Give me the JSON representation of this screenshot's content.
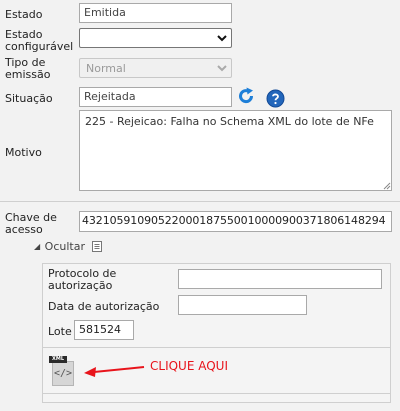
{
  "form": {
    "estado": {
      "label": "Estado",
      "value": "Emitida"
    },
    "estado_configuravel": {
      "label_line1": "Estado",
      "label_line2": "configurável",
      "value": ""
    },
    "tipo_emissao": {
      "label_line1": "Tipo de",
      "label_line2": "emissão",
      "value": "Normal"
    },
    "situacao": {
      "label": "Situação",
      "value": "Rejeitada"
    },
    "motivo": {
      "label": "Motivo",
      "value": "225 - Rejeicao: Falha no Schema XML do lote de NFe"
    },
    "chave_acesso": {
      "label_line1": "Chave de",
      "label_line2": "acesso",
      "value": "43210591090522000187550010000900371806148294"
    }
  },
  "section": {
    "toggle_label": "Ocultar",
    "protocolo": {
      "label_line1": "Protocolo de",
      "label_line2": "autorização",
      "value": ""
    },
    "data_autorizacao": {
      "label": "Data de autorização",
      "value": ""
    },
    "lote": {
      "label": "Lote",
      "value": "581524"
    }
  },
  "xml_icon": {
    "tag": "XML",
    "symbol": "</>"
  },
  "annotation": {
    "text": "CLIQUE AQUI",
    "color": "#e8141b"
  },
  "colors": {
    "refresh": "#1e7fd8",
    "help": "#2266bb",
    "arrow": "#e8141b"
  }
}
